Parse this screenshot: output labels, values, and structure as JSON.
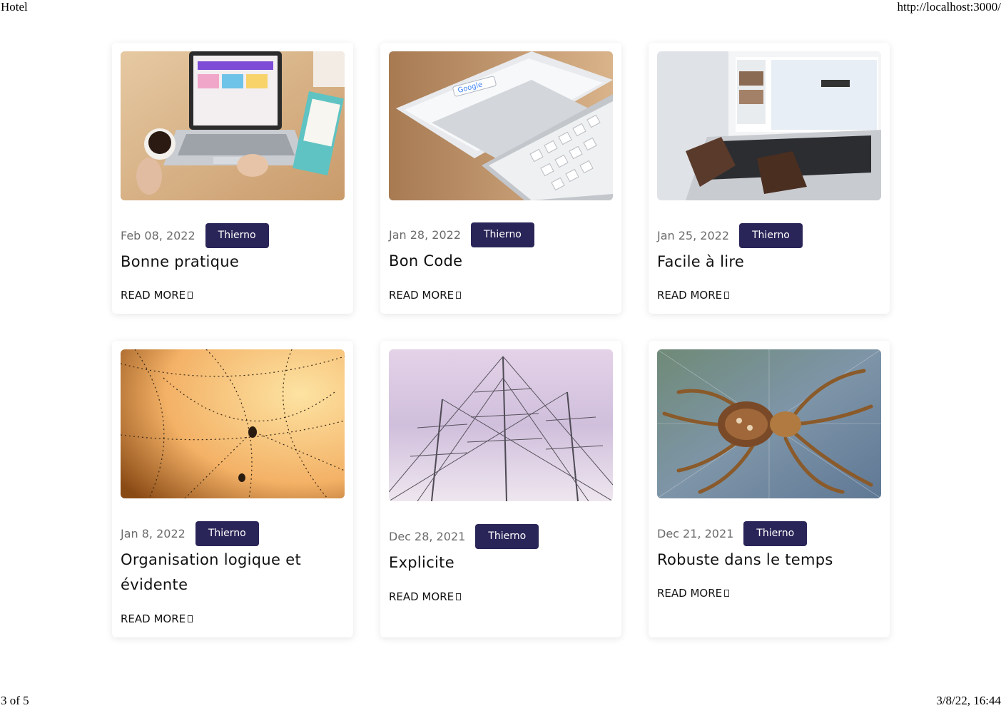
{
  "print": {
    "title": "Hotel",
    "url": "http://localhost:3000/",
    "page": "3 of 5",
    "datetime": "3/8/22, 16:44"
  },
  "posts": [
    {
      "date": "Feb 08, 2022",
      "author": "Thierno",
      "title": "Bonne pratique",
      "read_more": "READ MORE",
      "image": "laptop-coffee-photo"
    },
    {
      "date": "Jan 28, 2022",
      "author": "Thierno",
      "title": "Bon Code",
      "read_more": "READ MORE",
      "image": "tablet-keyboard-photo"
    },
    {
      "date": "Jan 25, 2022",
      "author": "Thierno",
      "title": "Facile à lire",
      "read_more": "READ MORE",
      "image": "laptop-typing-photo"
    },
    {
      "date": "Jan 8, 2022",
      "author": "Thierno",
      "title": "Organisation logique et évidente",
      "read_more": "READ MORE",
      "image": "spiderweb-dew-photo"
    },
    {
      "date": "Dec 28, 2021",
      "author": "Thierno",
      "title": "Explicite",
      "read_more": "READ MORE",
      "image": "ship-masts-photo"
    },
    {
      "date": "Dec 21, 2021",
      "author": "Thierno",
      "title": "Robuste dans le temps",
      "read_more": "READ MORE",
      "image": "spider-photo"
    }
  ]
}
